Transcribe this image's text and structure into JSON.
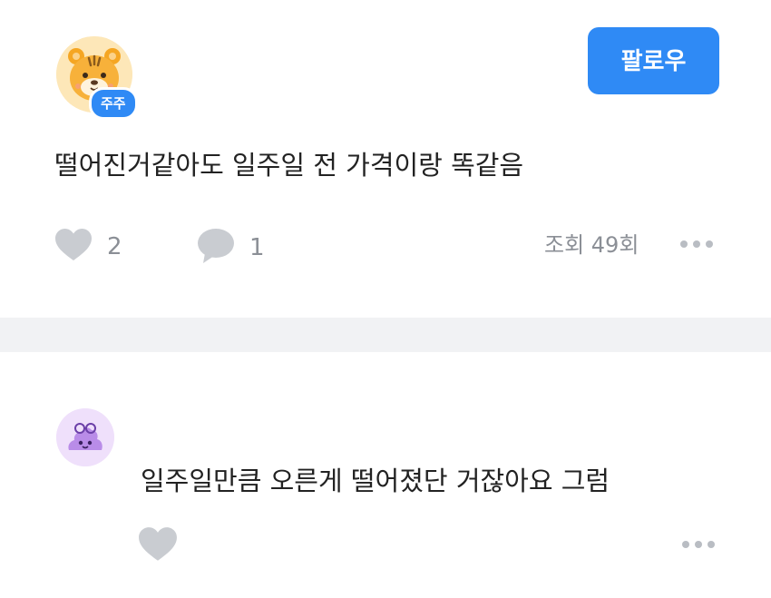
{
  "post": {
    "author_badge": "주주",
    "follow_label": "팔로우",
    "text": "떨어진거같아도 일주일 전 가격이랑 똑같음",
    "likes": "2",
    "comments": "1",
    "views": "조회 49회",
    "icons": {
      "avatar": "tiger-avatar-icon",
      "like": "heart-icon",
      "comment": "speech-bubble-icon",
      "more": "more-dots-icon"
    }
  },
  "comment": {
    "text": "일주일만큼 오른게 떨어졌단 거잖아요 그럼",
    "icons": {
      "avatar": "purple-blob-avatar-icon",
      "like": "heart-icon",
      "more": "more-dots-icon"
    }
  },
  "colors": {
    "accent": "#2f8af5",
    "muted_text": "#8b8f96",
    "icon_gray": "#c9ccd1",
    "divider": "#f1f2f4"
  }
}
